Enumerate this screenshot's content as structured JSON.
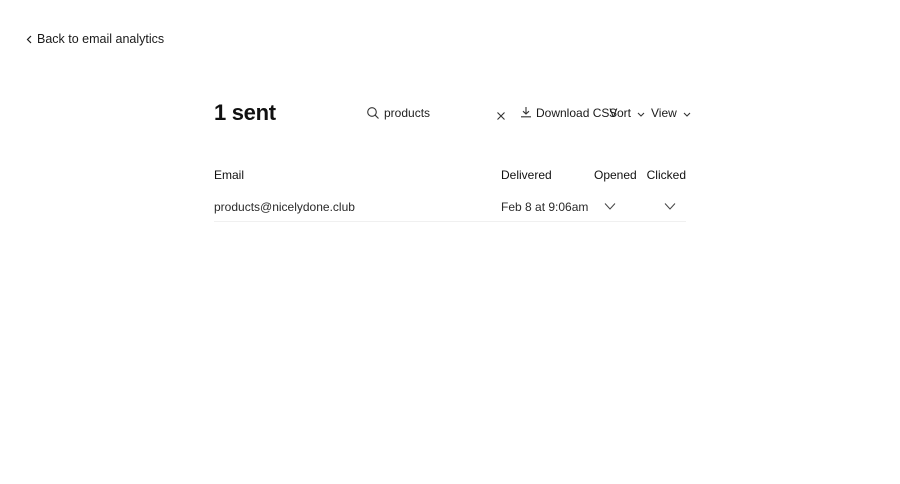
{
  "nav": {
    "back_label": "Back to email analytics"
  },
  "header": {
    "title": "1 sent"
  },
  "search": {
    "value": "products",
    "placeholder": "Search"
  },
  "toolbar": {
    "download_label": "Download CSV",
    "sort_label": "Sort",
    "view_label": "View"
  },
  "table": {
    "columns": [
      "Email",
      "Delivered",
      "Opened",
      "Clicked"
    ],
    "rows": [
      {
        "email": "products@nicelydone.club",
        "delivered": "Feb 8 at 9:06am",
        "opened": true,
        "clicked": true
      }
    ]
  },
  "icons": {
    "back": "chevron-left-icon",
    "search": "search-icon",
    "clear": "close-icon",
    "download": "download-icon",
    "dropdown": "chevron-down-icon",
    "check": "check-icon"
  },
  "colors": {
    "text": "#1a1a1a",
    "background": "#ffffff",
    "divider": "#f0f0f0"
  }
}
